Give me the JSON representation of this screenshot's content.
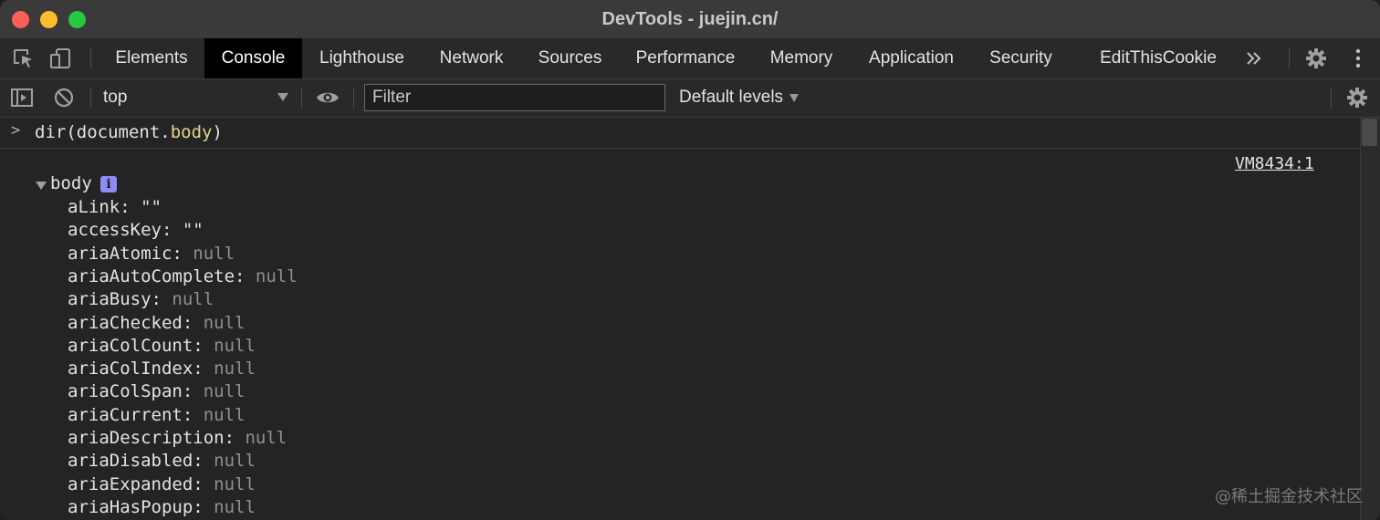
{
  "window": {
    "title": "DevTools - juejin.cn/"
  },
  "tabs": [
    {
      "label": "Elements"
    },
    {
      "label": "Console"
    },
    {
      "label": "Lighthouse"
    },
    {
      "label": "Network"
    },
    {
      "label": "Sources"
    },
    {
      "label": "Performance"
    },
    {
      "label": "Memory"
    },
    {
      "label": "Application"
    },
    {
      "label": "Security"
    },
    {
      "label": "EditThisCookie"
    }
  ],
  "active_tab": "Console",
  "toolbar": {
    "context": "top",
    "filter_placeholder": "Filter",
    "levels": "Default levels"
  },
  "console": {
    "prompt": ">",
    "command_prefix": "dir(document.",
    "command_prop": "body",
    "command_suffix": ")",
    "source": "VM8434:1",
    "root_label": "body",
    "info_badge": "i",
    "properties": [
      {
        "key": "aLink:",
        "value": "\"\"",
        "kind": "str"
      },
      {
        "key": "accessKey:",
        "value": "\"\"",
        "kind": "str"
      },
      {
        "key": "ariaAtomic:",
        "value": "null",
        "kind": "null"
      },
      {
        "key": "ariaAutoComplete:",
        "value": "null",
        "kind": "null"
      },
      {
        "key": "ariaBusy:",
        "value": "null",
        "kind": "null"
      },
      {
        "key": "ariaChecked:",
        "value": "null",
        "kind": "null"
      },
      {
        "key": "ariaColCount:",
        "value": "null",
        "kind": "null"
      },
      {
        "key": "ariaColIndex:",
        "value": "null",
        "kind": "null"
      },
      {
        "key": "ariaColSpan:",
        "value": "null",
        "kind": "null"
      },
      {
        "key": "ariaCurrent:",
        "value": "null",
        "kind": "null"
      },
      {
        "key": "ariaDescription:",
        "value": "null",
        "kind": "null"
      },
      {
        "key": "ariaDisabled:",
        "value": "null",
        "kind": "null"
      },
      {
        "key": "ariaExpanded:",
        "value": "null",
        "kind": "null"
      },
      {
        "key": "ariaHasPopup:",
        "value": "null",
        "kind": "null"
      }
    ]
  },
  "watermark": "@稀土掘金技术社区",
  "colors": {
    "titlebar": "#3a3a3a",
    "active_tab": "#000000",
    "property_prop_highlight": "#e0d68a",
    "null_value": "#8f8f8f",
    "info_badge": "#8c8ef2"
  }
}
